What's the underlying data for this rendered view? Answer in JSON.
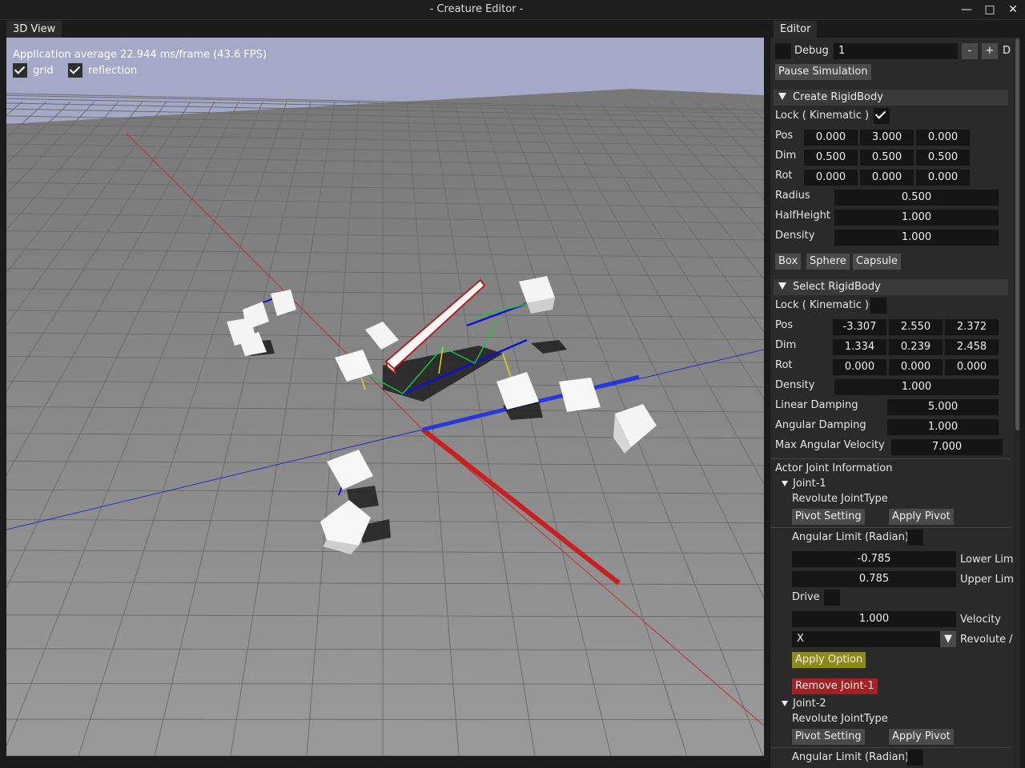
{
  "window": {
    "title": "- Creature Editor -"
  },
  "tabs": {
    "view3d": "3D View",
    "editor": "Editor"
  },
  "viewport": {
    "fps_text": "Application average 22.944 ms/frame (43.6 FPS)",
    "grid_label": "grid",
    "reflection_label": "reflection",
    "grid_checked": true,
    "reflection_checked": true
  },
  "editor": {
    "debug_label": "Debug",
    "debug_value": "1",
    "minus": "-",
    "plus": "+",
    "clipped_letter": "D",
    "pause_button": "Pause Simulation",
    "create": {
      "header": "Create RigidBody",
      "lock_label": "Lock ( Kinematic )",
      "lock_checked": true,
      "pos_label": "Pos",
      "pos": [
        "0.000",
        "3.000",
        "0.000"
      ],
      "dim_label": "Dim",
      "dim": [
        "0.500",
        "0.500",
        "0.500"
      ],
      "rot_label": "Rot",
      "rot": [
        "0.000",
        "0.000",
        "0.000"
      ],
      "radius_label": "Radius",
      "radius": "0.500",
      "halfheight_label": "HalfHeight",
      "halfheight": "1.000",
      "density_label": "Density",
      "density": "1.000",
      "box_button": "Box",
      "sphere_button": "Sphere",
      "capsule_button": "Capsule"
    },
    "select": {
      "header": "Select RigidBody",
      "lock_label": "Lock ( Kinematic )",
      "lock_checked": false,
      "pos_label": "Pos",
      "pos": [
        "-3.307",
        "2.550",
        "2.372"
      ],
      "dim_label": "Dim",
      "dim": [
        "1.334",
        "0.239",
        "2.458"
      ],
      "rot_label": "Rot",
      "rot": [
        "0.000",
        "0.000",
        "0.000"
      ],
      "density_label": "Density",
      "density": "1.000",
      "linear_damping_label": "Linear Damping",
      "linear_damping": "5.000",
      "angular_damping_label": "Angular Damping",
      "angular_damping": "1.000",
      "max_angular_velocity_label": "Max Angular Velocity",
      "max_angular_velocity": "7.000"
    },
    "joints": {
      "header": "Actor Joint Information",
      "joint1": {
        "name": "Joint-1",
        "type": "Revolute JointType",
        "pivot_setting": "Pivot Setting",
        "apply_pivot": "Apply Pivot",
        "angular_limit_label": "Angular Limit (Radian)",
        "lower_value": "-0.785",
        "lower_label": "Lower Lim",
        "upper_value": "0.785",
        "upper_label": "Upper Lim",
        "drive_label": "Drive",
        "velocity_value": "1.000",
        "velocity_label": "Velocity",
        "axis_value": "X",
        "axis_label": "Revolute /",
        "apply_option": "Apply Option",
        "remove": "Remove Joint-1"
      },
      "joint2": {
        "name": "Joint-2",
        "type": "Revolute JointType",
        "pivot_setting": "Pivot Setting",
        "apply_pivot": "Apply Pivot",
        "angular_limit_label": "Angular Limit (Radian)"
      }
    }
  },
  "colors": {
    "sky": "#a6a8c8",
    "floor": "#8a8a8a",
    "x_axis": "#c03030",
    "z_axis": "#2030c0",
    "apply_option": "#8b8b16",
    "remove_joint": "#a02222"
  }
}
